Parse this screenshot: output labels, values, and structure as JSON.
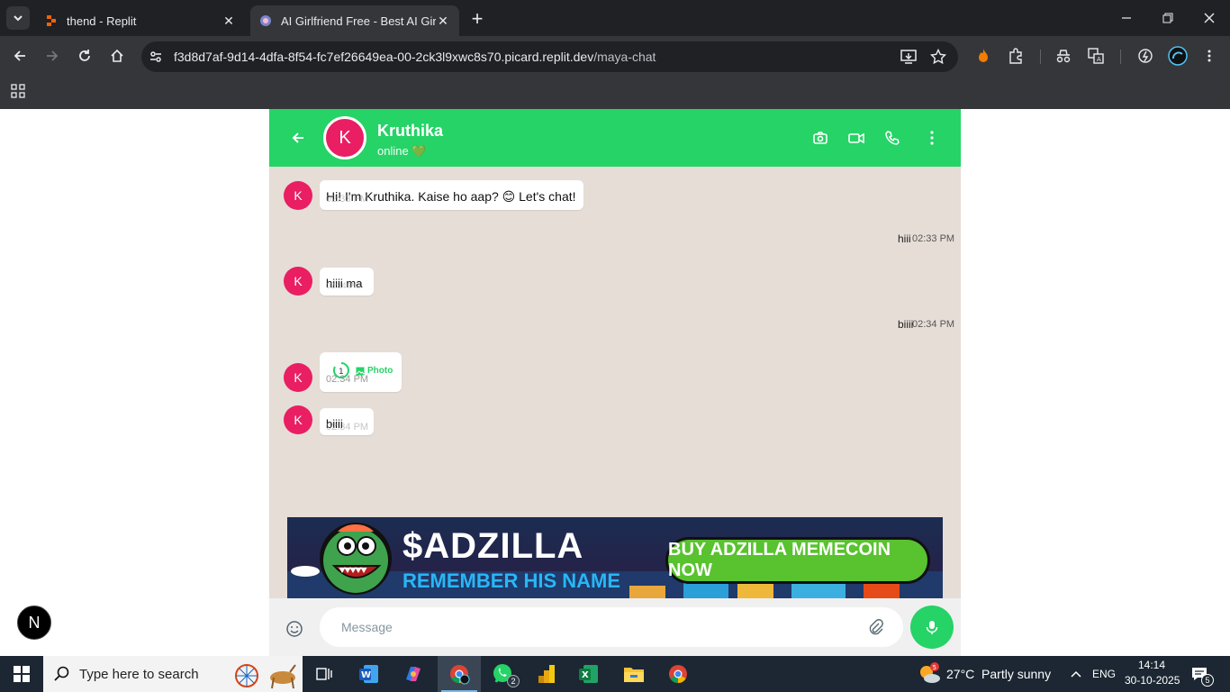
{
  "browser": {
    "tabs": [
      {
        "title": "thend - Replit",
        "active": false
      },
      {
        "title": "AI Girlfriend Free - Best AI Girlfr",
        "active": true
      }
    ],
    "url_host": "f3d8d7af-9d14-4dfa-8f54-fc7ef26649ea-00-2ck3l9xwc8s70.picard.replit.dev",
    "url_path": "/maya-chat"
  },
  "chat": {
    "contact": {
      "name": "Kruthika",
      "avatar_letter": "K",
      "status": "online 💚"
    },
    "messages": [
      {
        "dir": "in",
        "text": "Hi! I'm Kruthika. Kaise ho aap? 😊 Let's chat!",
        "time": "02:33 PM"
      },
      {
        "dir": "out",
        "text": "hiii",
        "time": "02:33 PM"
      },
      {
        "dir": "in",
        "text": "hiiii ma",
        "time": "02:34 PM"
      },
      {
        "dir": "out",
        "text": "biiii",
        "time": "02:34 PM"
      },
      {
        "dir": "in",
        "photo_label": "Photo",
        "loader_text": "1",
        "time": "02:34 PM"
      },
      {
        "dir": "in",
        "text": "biiii",
        "time": "02:34 PM"
      }
    ],
    "ad": {
      "title": "$ADZILLA",
      "subtitle": "REMEMBER HIS NAME",
      "button": "BUY ADZILLA MEMECOIN NOW"
    },
    "composer": {
      "placeholder": "Message"
    },
    "next_badge": "N"
  },
  "taskbar": {
    "search_placeholder": "Type here to search",
    "whatsapp_badge": "2",
    "weather_badge": "5",
    "weather": "27°C  Partly sunny",
    "lang": "ENG",
    "time": "14:14",
    "date": "30-10-2025",
    "notifications": "5"
  }
}
